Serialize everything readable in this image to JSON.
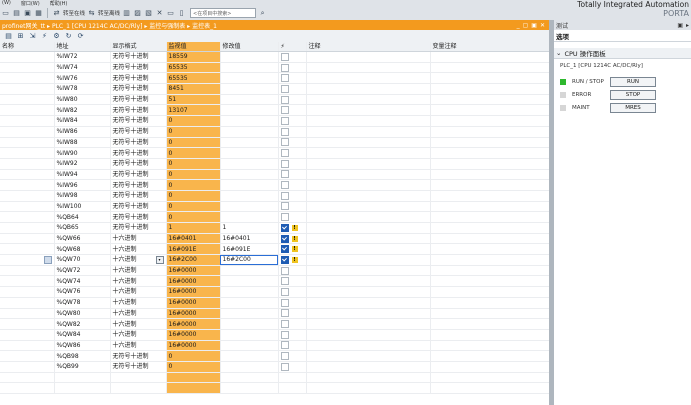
{
  "menu": {
    "items": [
      "(W)",
      "窗口(W)",
      "帮助(H)"
    ]
  },
  "toolbar": {
    "go_offline": "转至在线",
    "go_online": "转至离线",
    "search_placeholder": "<在项目中搜索>"
  },
  "brand": {
    "title": "Totally Integrated Automation",
    "sub": "PORTA"
  },
  "editor": {
    "breadcrumb": "profinet网关_tt ▸ PLC_1 [CPU 1214C AC/DC/Rly] ▸ 监控与强制表 ▸ 监控表_1"
  },
  "table": {
    "headers": {
      "name": "名称",
      "address": "地址",
      "format": "显示格式",
      "monitor": "监视值",
      "modify": "修改值",
      "comment": "注释",
      "var_comment": "变量注释"
    },
    "rows": [
      {
        "address": "%IW72",
        "format": "无符号十进制",
        "monitor": "18559",
        "modify": "",
        "chk": false,
        "warn": false
      },
      {
        "address": "%IW74",
        "format": "无符号十进制",
        "monitor": "65535",
        "modify": "",
        "chk": false,
        "warn": false
      },
      {
        "address": "%IW76",
        "format": "无符号十进制",
        "monitor": "65535",
        "modify": "",
        "chk": false,
        "warn": false
      },
      {
        "address": "%IW78",
        "format": "无符号十进制",
        "monitor": "8451",
        "modify": "",
        "chk": false,
        "warn": false
      },
      {
        "address": "%IW80",
        "format": "无符号十进制",
        "monitor": "51",
        "modify": "",
        "chk": false,
        "warn": false
      },
      {
        "address": "%IW82",
        "format": "无符号十进制",
        "monitor": "13107",
        "modify": "",
        "chk": false,
        "warn": false
      },
      {
        "address": "%IW84",
        "format": "无符号十进制",
        "monitor": "0",
        "modify": "",
        "chk": false,
        "warn": false
      },
      {
        "address": "%IW86",
        "format": "无符号十进制",
        "monitor": "0",
        "modify": "",
        "chk": false,
        "warn": false
      },
      {
        "address": "%IW88",
        "format": "无符号十进制",
        "monitor": "0",
        "modify": "",
        "chk": false,
        "warn": false
      },
      {
        "address": "%IW90",
        "format": "无符号十进制",
        "monitor": "0",
        "modify": "",
        "chk": false,
        "warn": false
      },
      {
        "address": "%IW92",
        "format": "无符号十进制",
        "monitor": "0",
        "modify": "",
        "chk": false,
        "warn": false
      },
      {
        "address": "%IW94",
        "format": "无符号十进制",
        "monitor": "0",
        "modify": "",
        "chk": false,
        "warn": false
      },
      {
        "address": "%IW96",
        "format": "无符号十进制",
        "monitor": "0",
        "modify": "",
        "chk": false,
        "warn": false
      },
      {
        "address": "%IW98",
        "format": "无符号十进制",
        "monitor": "0",
        "modify": "",
        "chk": false,
        "warn": false
      },
      {
        "address": "%IW100",
        "format": "无符号十进制",
        "monitor": "0",
        "modify": "",
        "chk": false,
        "warn": false
      },
      {
        "address": "%QB64",
        "format": "无符号十进制",
        "monitor": "0",
        "modify": "",
        "chk": false,
        "warn": false
      },
      {
        "address": "%QB65",
        "format": "无符号十进制",
        "monitor": "1",
        "modify": "1",
        "chk": true,
        "warn": true
      },
      {
        "address": "%QW66",
        "format": "十六进制",
        "monitor": "16#0401",
        "modify": "16#0401",
        "chk": true,
        "warn": true
      },
      {
        "address": "%QW68",
        "format": "十六进制",
        "monitor": "16#091E",
        "modify": "16#091E",
        "chk": true,
        "warn": true
      },
      {
        "address": "%QW70",
        "format": "十六进制",
        "monitor": "16#2C00",
        "modify": "16#2C00",
        "chk": true,
        "warn": true,
        "focus": true
      },
      {
        "address": "%QW72",
        "format": "十六进制",
        "monitor": "16#0000",
        "modify": "",
        "chk": false,
        "warn": false
      },
      {
        "address": "%QW74",
        "format": "十六进制",
        "monitor": "16#0000",
        "modify": "",
        "chk": false,
        "warn": false
      },
      {
        "address": "%QW76",
        "format": "十六进制",
        "monitor": "16#0000",
        "modify": "",
        "chk": false,
        "warn": false
      },
      {
        "address": "%QW78",
        "format": "十六进制",
        "monitor": "16#0000",
        "modify": "",
        "chk": false,
        "warn": false
      },
      {
        "address": "%QW80",
        "format": "十六进制",
        "monitor": "16#0000",
        "modify": "",
        "chk": false,
        "warn": false
      },
      {
        "address": "%QW82",
        "format": "十六进制",
        "monitor": "16#0000",
        "modify": "",
        "chk": false,
        "warn": false
      },
      {
        "address": "%QW84",
        "format": "十六进制",
        "monitor": "16#0000",
        "modify": "",
        "chk": false,
        "warn": false
      },
      {
        "address": "%QW86",
        "format": "十六进制",
        "monitor": "16#0000",
        "modify": "",
        "chk": false,
        "warn": false
      },
      {
        "address": "%QB98",
        "format": "无符号十进制",
        "monitor": "0",
        "modify": "",
        "chk": false,
        "warn": false
      },
      {
        "address": "%QB99",
        "format": "无符号十进制",
        "monitor": "0",
        "modify": "",
        "chk": false,
        "warn": false
      },
      {
        "address": "",
        "format": "",
        "monitor": "",
        "modify": "",
        "chk": false,
        "warn": false,
        "blank": true
      },
      {
        "address": "",
        "format": "",
        "monitor": "",
        "modify": "",
        "chk": false,
        "warn": false,
        "blank": true
      }
    ]
  },
  "right_panel": {
    "title": "测试",
    "options": "选项",
    "section": "CPU 操作面板",
    "plc": "PLC_1 [CPU 1214C AC/DC/Rly]",
    "rows": [
      {
        "label": "RUN / STOP",
        "button": "RUN",
        "led": "green"
      },
      {
        "label": "ERROR",
        "button": "STOP",
        "led": "grey"
      },
      {
        "label": "MAINT",
        "button": "MRES",
        "led": "grey"
      }
    ]
  },
  "colors": {
    "accent": "#f39a1e",
    "monitor_cell": "#f9b54c",
    "run_led": "#2eb82e"
  }
}
